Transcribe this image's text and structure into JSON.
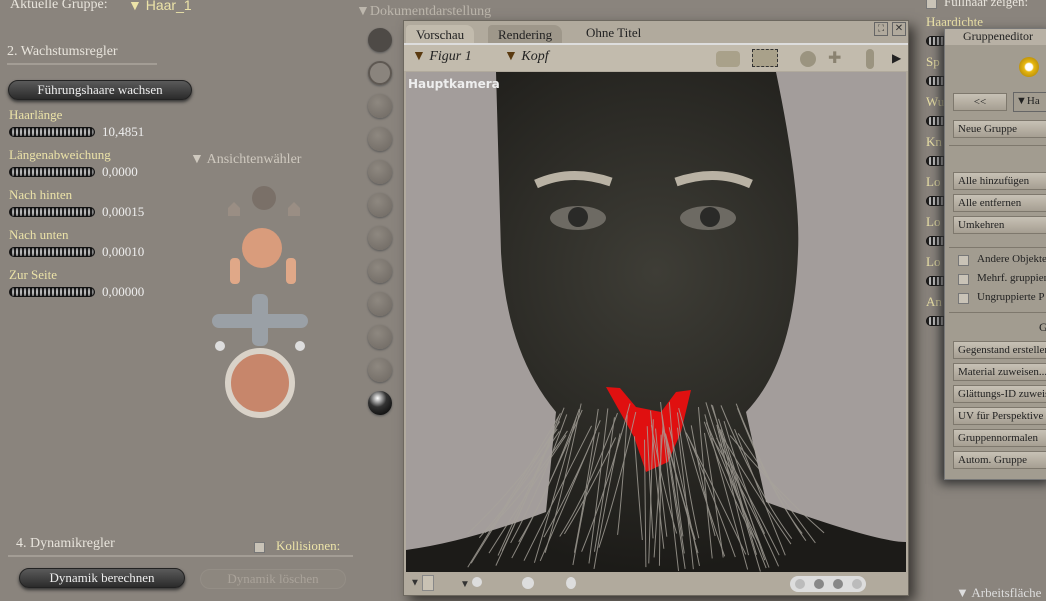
{
  "header": {
    "group_label": "Aktuelle Gruppe:",
    "group_value": "Haar_1"
  },
  "growth": {
    "title": "2. Wachstumsregler",
    "grow_button": "Führungshaare wachsen",
    "sliders": [
      {
        "label": "Haarlänge",
        "value": "10,4851"
      },
      {
        "label": "Längenabweichung",
        "value": "0,0000"
      },
      {
        "label": "Nach hinten",
        "value": "0,00015"
      },
      {
        "label": "Nach unten",
        "value": "0,00010"
      },
      {
        "label": "Zur Seite",
        "value": "0,00000"
      }
    ]
  },
  "view_selector": {
    "label": "Ansichtenwähler"
  },
  "doc_display": {
    "label": "Dokumentdarstellung"
  },
  "dynamics": {
    "title": "4. Dynamikregler",
    "collisions_label": "Kollisionen:",
    "collisions_checked": false,
    "calc_button": "Dynamik berechnen",
    "clear_button": "Dynamik löschen"
  },
  "viewport": {
    "tabs": [
      "Vorschau",
      "Rendering"
    ],
    "title": "Ohne Titel",
    "figure_menu": "Figur 1",
    "part_menu": "Kopf",
    "camera_label": "Hauptkamera"
  },
  "right": {
    "show_fill_label": "Füllhaar zeigen:",
    "show_fill_checked": false,
    "sliders": [
      "Haardichte",
      "Sp",
      "Wu",
      "Kn",
      "Lo",
      "Lo",
      "Lo",
      "An"
    ],
    "bottom_label": "Arbeitsfläche"
  },
  "group_editor": {
    "title": "Gruppeneditor",
    "prev_button": "<<",
    "group_select": "Ha",
    "new_group": "Neue Gruppe",
    "buttons_a": [
      "Alle hinzufügen",
      "Alle entfernen",
      "Umkehren"
    ],
    "checkboxes": [
      {
        "label": "Andere Objekte",
        "checked": false
      },
      {
        "label": "Mehrf. gruppiert",
        "checked": false
      },
      {
        "label": "Ungruppierte P",
        "checked": false
      }
    ],
    "section": "G",
    "buttons_b": [
      "Gegenstand erstellen",
      "Material zuweisen...",
      "Glättungs-ID zuweisen",
      "UV für Perspektive",
      "Gruppennormalen",
      "Autom. Gruppe"
    ]
  },
  "colors": {
    "label_yellow": "#ece3a8",
    "beard_red": "#e01010",
    "canvas_bg": "#a39d9b"
  }
}
